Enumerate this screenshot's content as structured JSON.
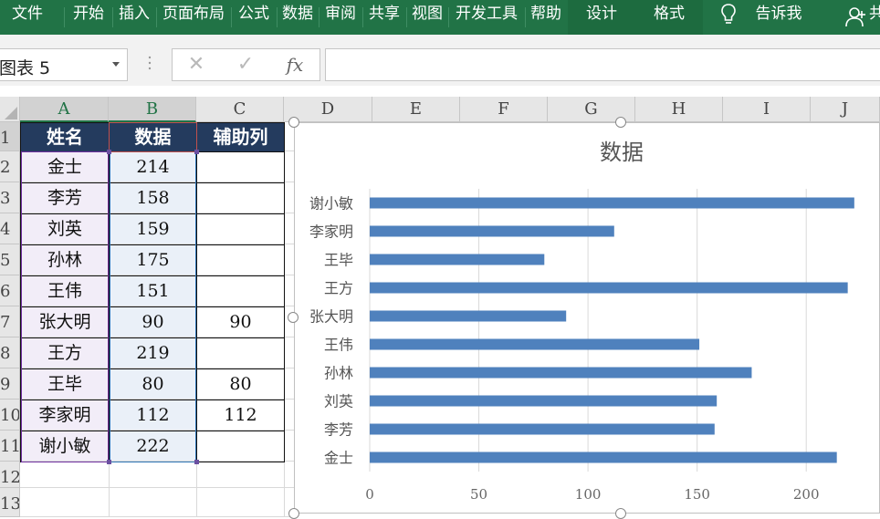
{
  "ribbon": {
    "tabs": [
      "文件",
      "开始",
      "插入",
      "页面布局",
      "公式",
      "数据",
      "审阅",
      "共享",
      "视图",
      "开发工具",
      "帮助"
    ],
    "context_tabs": [
      "设计",
      "格式"
    ],
    "tell_me": "告诉我",
    "share_partial": "共"
  },
  "formula_bar": {
    "name_box": "图表 5",
    "cancel": "✕",
    "enter": "✓",
    "fx": "fx",
    "formula": ""
  },
  "grid": {
    "columns": [
      "A",
      "B",
      "C",
      "D",
      "E",
      "F",
      "G",
      "H",
      "I",
      "J"
    ],
    "rows": [
      "1",
      "2",
      "3",
      "4",
      "5",
      "6",
      "7",
      "8",
      "9",
      "10",
      "11",
      "12",
      "13"
    ],
    "selected_columns": [
      "A",
      "B"
    ],
    "selected_rows": [
      "1"
    ]
  },
  "table": {
    "headers": [
      "姓名",
      "数据",
      "辅助列"
    ],
    "rows": [
      [
        "金士",
        "214",
        ""
      ],
      [
        "李芳",
        "158",
        ""
      ],
      [
        "刘英",
        "159",
        ""
      ],
      [
        "孙林",
        "175",
        ""
      ],
      [
        "王伟",
        "151",
        ""
      ],
      [
        "张大明",
        "90",
        "90"
      ],
      [
        "王方",
        "219",
        ""
      ],
      [
        "王毕",
        "80",
        "80"
      ],
      [
        "李家明",
        "112",
        "112"
      ],
      [
        "谢小敏",
        "222",
        ""
      ]
    ]
  },
  "chart_data": {
    "type": "bar",
    "orientation": "horizontal",
    "title": "数据",
    "categories": [
      "谢小敏",
      "李家明",
      "王毕",
      "王方",
      "张大明",
      "王伟",
      "孙林",
      "刘英",
      "李芳",
      "金士"
    ],
    "values": [
      222,
      112,
      80,
      219,
      90,
      151,
      175,
      159,
      158,
      214
    ],
    "x_ticks": [
      "0",
      "50",
      "100",
      "150",
      "200"
    ],
    "xlim": [
      0,
      225
    ],
    "grid": "vertical",
    "legend": "none",
    "bar_color": "#4f81bd"
  },
  "colors": {
    "ribbon": "#217346",
    "header_fill": "#243b5e",
    "name_col_fill": "#f2edf8",
    "data_col_fill": "#eaf0f8",
    "name_col_border": "#7030a0",
    "data_col_border": "#2e75b6",
    "header_border": "#c0504d"
  }
}
